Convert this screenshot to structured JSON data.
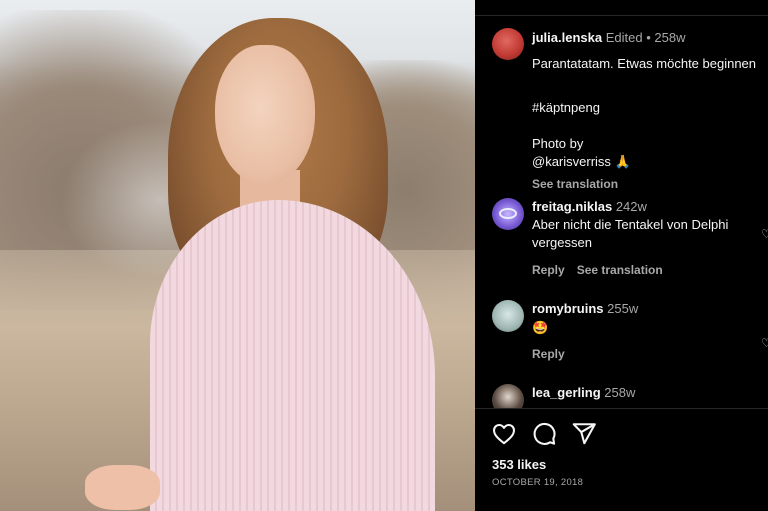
{
  "post": {
    "likes": "353 likes",
    "date": "OCTOBER 19, 2018"
  },
  "caption": {
    "username": "julia.lenska",
    "edited": "Edited",
    "dot": "•",
    "age": "258w",
    "line1": "Parantatatam. Etwas möchte beginnen",
    "line2": "#käptnpeng",
    "line3": "Photo by",
    "line4": "@karisverriss 🙏",
    "see_translation": "See translation"
  },
  "comments": [
    {
      "username": "freitag.niklas",
      "age": "242w",
      "line1": "Aber nicht die Tentakel von Delphi",
      "line2": "vergessen",
      "reply": "Reply",
      "see_translation": "See translation"
    },
    {
      "username": "romybruins",
      "age": "255w",
      "text": "🤩",
      "reply": "Reply"
    },
    {
      "username": "lea_gerling",
      "age": "258w"
    }
  ],
  "icons": {
    "like": "heart-icon",
    "comment": "comment-icon",
    "share": "share-icon",
    "comment_like": "heart-icon"
  },
  "colors": {
    "background": "#000000",
    "text": "#f5f5f5",
    "secondary_text": "#a8a8a8",
    "divider": "#262626"
  }
}
